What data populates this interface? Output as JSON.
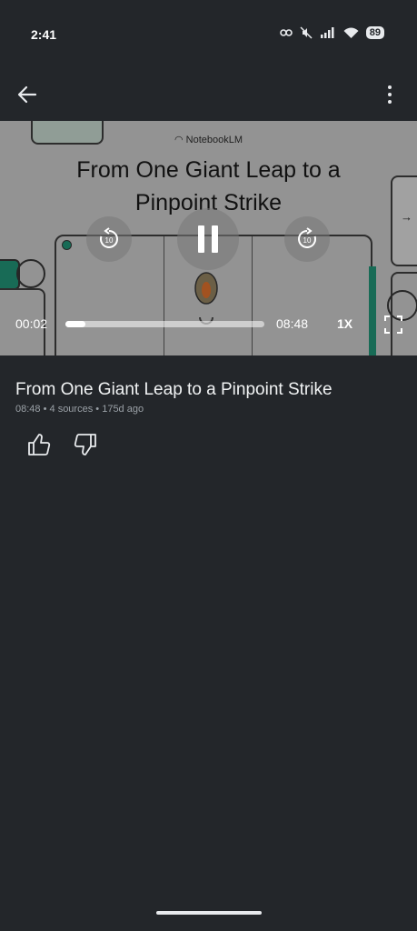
{
  "status_bar": {
    "time": "2:41",
    "battery": "89"
  },
  "video": {
    "brand": "NotebookLM",
    "title_line1": "From One Giant Leap to a",
    "title_line2": "Pinpoint Strike",
    "rewind_seconds": "10",
    "forward_seconds": "10",
    "elapsed": "00:02",
    "duration": "08:48",
    "progress_fraction": 0.004,
    "speed": "1X"
  },
  "episode": {
    "title": "From One Giant Leap to a Pinpoint Strike",
    "duration": "08:48",
    "sources": "4 sources",
    "age": "175d ago",
    "separator": "•"
  },
  "colors": {
    "background": "#23262a",
    "accent_teal": "#1f8a6f"
  }
}
